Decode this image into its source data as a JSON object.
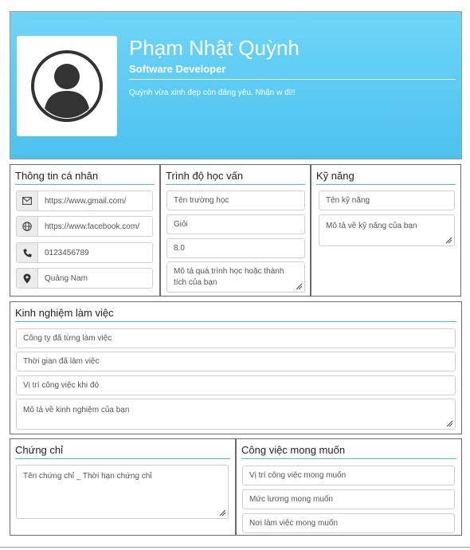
{
  "profile": {
    "name": "Phạm Nhật Quỳnh",
    "role": "Software Developer",
    "bio": "Quỳnh vừa xinh đẹp còn đáng yêu. Nhận w đi!!"
  },
  "personal": {
    "title": "Thông tin cá nhân",
    "email": "https://www.gmail.com/",
    "facebook": "https://www.facebook.com/",
    "phone": "0123456789",
    "address": "Quảng Nam"
  },
  "education": {
    "title": "Trình độ học vấn",
    "school": "Tên trường học",
    "rank": "Giỏi",
    "score": "8.0",
    "description": "Mô tả quá trình học hoặc thành tích của bạn"
  },
  "skills": {
    "title": "Kỹ năng",
    "name_placeholder": "Tên kỹ năng",
    "desc_placeholder": "Mô tả về kỹ năng của bạn"
  },
  "experience": {
    "title": "Kinh nghiệm làm việc",
    "company": "Công ty đã từng làm việc",
    "duration": "Thời gian đã làm việc",
    "position": "Vị trí công việc khi đó",
    "description": "Mô tả về kinh nghiệm của bạn"
  },
  "certificates": {
    "title": "Chứng chỉ",
    "placeholder": "Tên chứng chỉ _ Thời hạn chứng chỉ"
  },
  "desired_job": {
    "title": "Công việc mong muốn",
    "position": "Vị trí công việc mong muốn",
    "salary": "Mức lương mong muốn",
    "location": "Nơi làm việc mong muốn"
  },
  "icons": [
    "user-avatar-icon",
    "envelope-icon",
    "globe-icon",
    "phone-icon",
    "location-pin-icon",
    "resize-grip-icon"
  ],
  "colors": {
    "header_gradient_top": "#6fd5f7",
    "header_gradient_bottom": "#4cc2f0",
    "title_rule": "#4fb9d8"
  }
}
